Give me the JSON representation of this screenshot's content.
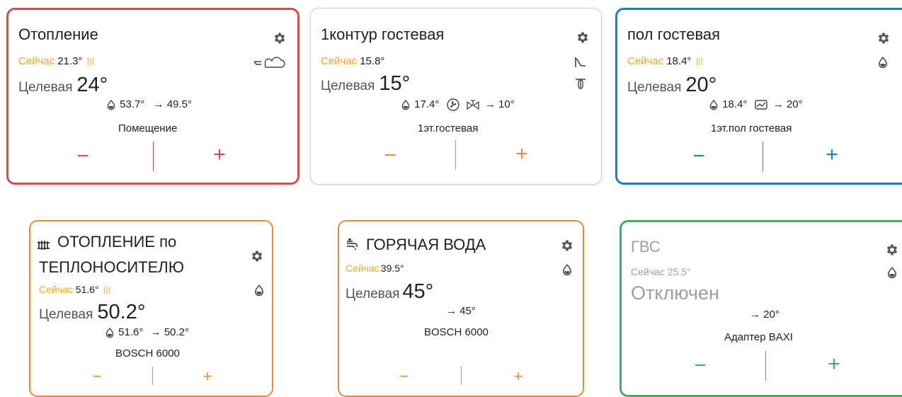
{
  "colors": {
    "heat": "#db4a4a",
    "neutral": "#f08a2b",
    "cool": "#1e7fb6",
    "water": "#e48a3c",
    "off": "#45ad5f",
    "now_label": "#f5a623"
  },
  "cards": [
    {
      "title": "Отопление",
      "now_label": "Сейчас",
      "now_value": "21.3°",
      "target_label": "Целевая",
      "target_value": "24°",
      "sub_a": "53.7°",
      "sub_b": "→ 49.5°",
      "room": "Помещение",
      "minus": "−",
      "plus": "+",
      "icons": [
        "gear-icon",
        "heating-waves-icon",
        "wind-cloud-icon",
        "drop-icon"
      ]
    },
    {
      "title": "1контур гостевая",
      "now_label": "Сейчас",
      "now_value": "15.8°",
      "target_label": "Целевая",
      "target_value": "15°",
      "sub_a": "17.4°",
      "sub_b": "→ 10°",
      "room": "1эт.гостевая",
      "minus": "−",
      "plus": "+",
      "icons": [
        "gear-icon",
        "curve-icon",
        "thermostat-icon",
        "drop-icon",
        "fan-icon",
        "valve-icon"
      ]
    },
    {
      "title": "пол гостевая",
      "now_label": "Сейчас",
      "now_value": "18.4°",
      "target_label": "Целевая",
      "target_value": "20°",
      "sub_a": "18.4°",
      "sub_b": "→ 20°",
      "room": "1эт.пол гостевая",
      "minus": "−",
      "plus": "+",
      "icons": [
        "gear-icon",
        "heating-waves-icon",
        "drop-icon",
        "chart-icon"
      ]
    },
    {
      "title_line1": "ОТОПЛЕНИЕ по",
      "title_line2": "ТЕПЛОНОСИТЕЛЮ",
      "now_label": "Сейчас",
      "now_value": "51.6°",
      "target_label": "Целевая",
      "target_value": "50.2°",
      "sub_a": "51.6°",
      "sub_b": "→ 50.2°",
      "room": "BOSCH 6000",
      "minus": "−",
      "plus": "+",
      "icons": [
        "radiator-icon",
        "gear-icon",
        "heating-waves-icon",
        "drop-icon"
      ]
    },
    {
      "title": "ГОРЯЧАЯ ВОДА",
      "now_label": "Сейчас",
      "now_value": "39.5°",
      "target_label": "Целевая",
      "target_value": "45°",
      "sub_b": "→ 45°",
      "room": "BOSCH 6000",
      "minus": "−",
      "plus": "+",
      "icons": [
        "faucet-icon",
        "gear-icon",
        "drop-icon"
      ]
    },
    {
      "title": "ГВС",
      "now_label": "Сейчас",
      "now_value": "25.5°",
      "status": "Отключен",
      "sub_b": "→ 20°",
      "room": "Адаптер BAXI",
      "minus": "−",
      "plus": "+",
      "icons": [
        "gear-icon",
        "drop-icon"
      ]
    }
  ]
}
